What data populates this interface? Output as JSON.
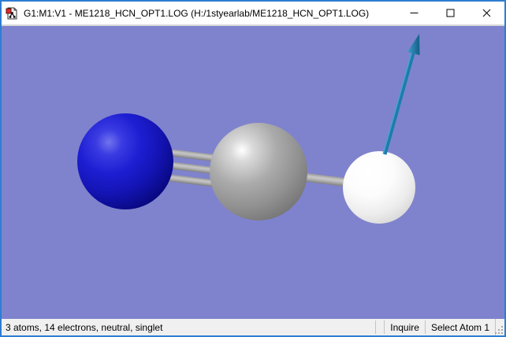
{
  "window": {
    "title": "G1:M1:V1 - ME1218_HCN_OPT1.LOG (H:/1styearlab/ME1218_HCN_OPT1.LOG)",
    "border_color": "#2e7dd2",
    "controls": {
      "minimize_icon": "minimize",
      "maximize_icon": "maximize",
      "close_icon": "close"
    }
  },
  "viewport": {
    "background_color": "#7f83cd",
    "molecule": {
      "name": "HCN",
      "atoms": [
        {
          "element": "Nitrogen",
          "symbol": "N",
          "color": "#1d1ed2"
        },
        {
          "element": "Carbon",
          "symbol": "C",
          "color": "#9a9a9a"
        },
        {
          "element": "Hydrogen",
          "symbol": "H",
          "color": "#f5f5f5"
        }
      ],
      "bonds": [
        {
          "from": "N",
          "to": "C",
          "order": 3
        },
        {
          "from": "C",
          "to": "H",
          "order": 1
        }
      ],
      "dipole_arrow": {
        "color": "#1d7cad",
        "direction": "up-right"
      }
    }
  },
  "status_bar": {
    "summary": "3 atoms, 14 electrons, neutral, singlet",
    "inquire_label": "Inquire",
    "select_label": "Select Atom 1"
  }
}
